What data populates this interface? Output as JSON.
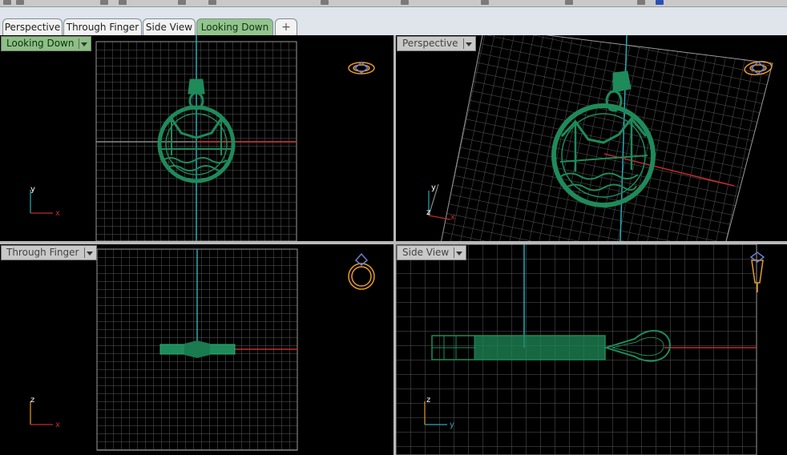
{
  "tabs": [
    {
      "label": "Perspective",
      "active": false
    },
    {
      "label": "Through Finger",
      "active": false
    },
    {
      "label": "Side View",
      "active": false
    },
    {
      "label": "Looking Down",
      "active": true
    }
  ],
  "tab_add_label": "+",
  "viewports": {
    "top_left": {
      "label": "Looking Down",
      "axis_labels": [
        "y",
        "x"
      ]
    },
    "top_right": {
      "label": "Perspective",
      "axis_labels": [
        "y",
        "z",
        "x"
      ]
    },
    "bottom_left": {
      "label": "Through Finger",
      "axis_labels": [
        "z",
        "x"
      ]
    },
    "bottom_right": {
      "label": "Side View",
      "axis_labels": [
        "z",
        "y"
      ]
    }
  },
  "colors": {
    "background": "#000000",
    "grid": "#9a9a9a",
    "model": "#1f8a5a",
    "axis_x": "#c22a2a",
    "axis_y": "#2aa9b5",
    "gizmo": "#e59b2a",
    "active_label": "#8cc084"
  }
}
